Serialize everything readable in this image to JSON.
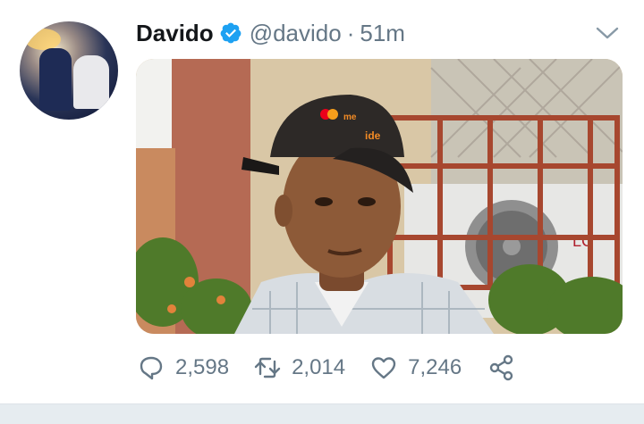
{
  "tweet": {
    "author_name": "Davido",
    "handle": "@davido",
    "separator": "·",
    "time": "51m",
    "verified": true,
    "media": {
      "cap_text_left": "me",
      "cap_text_right": "ide",
      "ac_brand": "LG"
    },
    "stats": {
      "replies": "2,598",
      "retweets": "2,014",
      "likes": "7,246"
    }
  },
  "colors": {
    "verified_blue": "#1da1f2",
    "muted_gray": "#657786",
    "text_dark": "#14171a"
  },
  "icons": [
    "verified-badge-icon",
    "chevron-down-icon",
    "reply-icon",
    "retweet-icon",
    "like-icon",
    "share-icon"
  ]
}
